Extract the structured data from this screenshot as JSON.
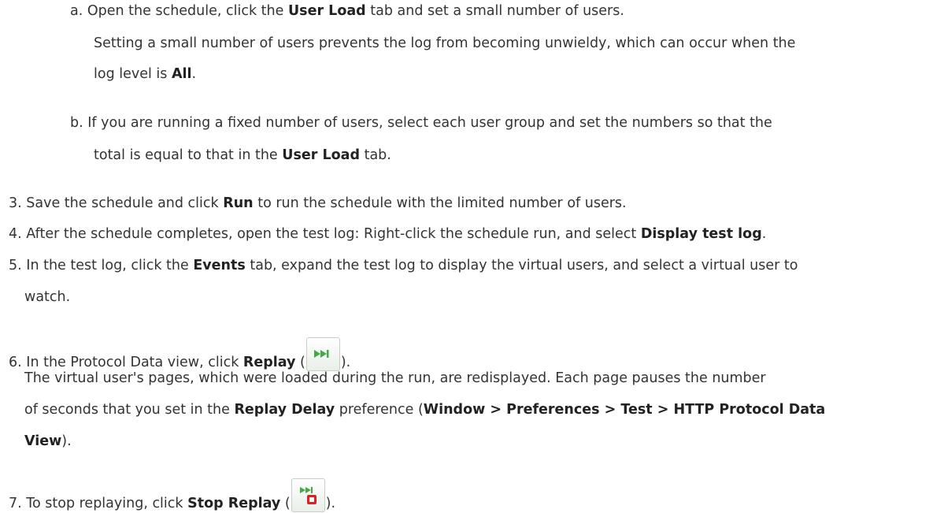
{
  "steps": {
    "a": {
      "marker": "a.",
      "p1_pre": "Open the schedule, click the ",
      "p1_bold": "User Load",
      "p1_post": " tab and set a small number of users.",
      "p2_line1": "Setting a small number of users prevents the log from becoming unwieldy, which can occur when the",
      "p2_pre": "log level is ",
      "p2_bold": "All",
      "p2_post": "."
    },
    "b": {
      "marker": "b.",
      "line1": "If you are running a fixed number of users, select each user group and set the numbers so that the",
      "l2_pre": "total is equal to that in the ",
      "l2_bold": "User Load",
      "l2_post": " tab."
    },
    "s3": {
      "marker": "3.",
      "pre": "Save the schedule and click ",
      "bold": "Run",
      "post": " to run the schedule with the limited number of users."
    },
    "s4": {
      "marker": "4.",
      "pre": "After the schedule completes, open the test log: Right-click the schedule run, and select ",
      "bold": "Display test log",
      "post": "."
    },
    "s5": {
      "marker": "5.",
      "pre": "In the test log, click the ",
      "bold": "Events",
      "post": " tab, expand the test log to display the virtual users, and select a virtual user to",
      "line2": "watch."
    },
    "s6": {
      "marker": "6.",
      "pre": "In the Protocol Data view, click ",
      "bold": "Replay",
      "open_paren": " (",
      "close_paren": ").",
      "icon": "replay-icon",
      "desc_line1": "The virtual user's pages, which were loaded during the run, are redisplayed. Each page pauses the number",
      "desc_l2_pre": "of seconds that you set in the ",
      "desc_l2_bold1": "Replay Delay",
      "desc_l2_mid": " preference (",
      "desc_l2_bold2": "Window > Preferences > Test > HTTP Protocol Data",
      "desc_l3_bold": "View",
      "desc_l3_post": ")."
    },
    "s7": {
      "marker": "7.",
      "pre": "To stop replaying, click ",
      "bold": "Stop Replay",
      "open_paren": " (",
      "close_paren": ").",
      "icon": "stop-replay-icon"
    }
  },
  "colors": {
    "text": "#333333",
    "icon_green": "#44aa44",
    "icon_red": "#dd2222"
  }
}
